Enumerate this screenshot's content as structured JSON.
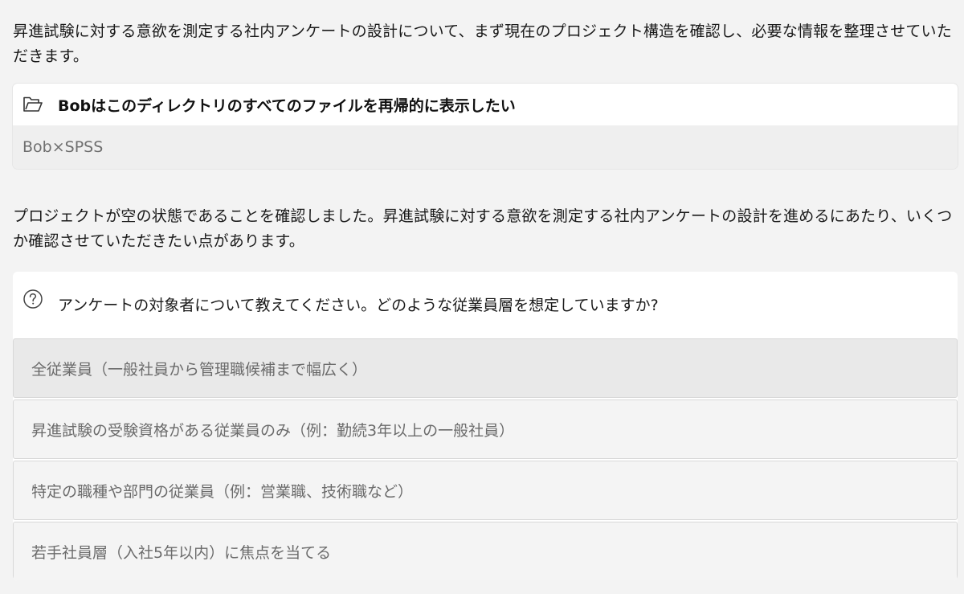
{
  "intro_text": "昇進試験に対する意欲を測定する社内アンケートの設計について、まず現在のプロジェクト構造を確認し、必要な情報を整理させていただきます。",
  "tool_call": {
    "icon": "folder-open-icon",
    "title": "Bobはこのディレクトリのすべてのファイルを再帰的に表示したい",
    "result": "Bob×SPSS"
  },
  "status_text": "プロジェクトが空の状態であることを確認しました。昇進試験に対する意欲を測定する社内アンケートの設計を進めるにあたり、いくつか確認させていただきたい点があります。",
  "question": {
    "icon": "question-circle-icon",
    "text": "アンケートの対象者について教えてください。どのような従業員層を想定していますか?",
    "options": [
      "全従業員（一般社員から管理職候補まで幅広く）",
      "昇進試験の受験資格がある従業員のみ（例：勤続3年以上の一般社員）",
      "特定の職種や部門の従業員（例：営業職、技術職など）",
      "若手社員層（入社5年以内）に焦点を当てる"
    ],
    "selected_index": 0
  }
}
